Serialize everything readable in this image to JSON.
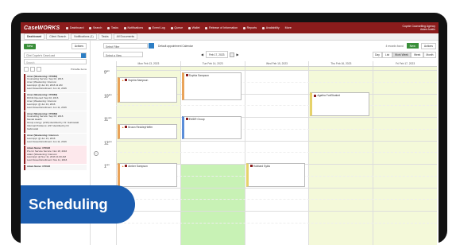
{
  "app": {
    "logo": "CaseWORKS"
  },
  "nav": [
    {
      "label": "Dashboard"
    },
    {
      "label": "Search"
    },
    {
      "label": "Tasks"
    },
    {
      "label": "Notifications"
    },
    {
      "label": "Event Log"
    },
    {
      "label": "Queue"
    },
    {
      "label": "Wallet"
    },
    {
      "label": "Release of Information"
    },
    {
      "label": "Reports"
    },
    {
      "label": "Availability"
    },
    {
      "label": "More"
    }
  ],
  "account": {
    "org": "Coyote Counselling Agency",
    "user": "Adam Austin"
  },
  "tabs": [
    {
      "label": "Dashboard",
      "active": true
    },
    {
      "label": "Client Search",
      "active": false
    },
    {
      "label": "Notifications (1)",
      "active": false
    },
    {
      "label": "Tasks",
      "active": false
    },
    {
      "label": "All Documents",
      "active": false
    }
  ],
  "sidebar": {
    "new_label": "New",
    "actions_label": "Actions",
    "caseload_select": "Clint Coyote's CaseLoad",
    "search_placeholder": "Search",
    "select_label": "Printable Items",
    "cards": [
      {
        "lines": [
          "Amer (Weekening: #70083)",
          "Counseling    Service: Sep 02, 2016",
          "Amer (Weekening: Intenvon",
          "Last Appt: @ Jun 13, 2016 11 AM",
          "Last Closed Enrollment: Jun 11, 2016"
        ],
        "pink": false
      },
      {
        "lines": [
          "Amer (Weekening: #70083)",
          "DCNA    Opened: Sep 02, 2016",
          "Amer (Weekening: Intenvon",
          "Last Appt: @ Jun 13, 2016",
          "Last Closed Enrollment: Jun 11, 2016"
        ],
        "pink": false
      },
      {
        "lines": [
          "Amer (Weekening: #70083)",
          "Counseling    Service: Sep 02, 2016",
          "Mental Health",
          "Group energy: (2/16) identified by: Dr. Gabrowski",
          "Informal Problems: 2/27 identified by Dr.",
          "Gabrowski"
        ],
        "pink": false
      },
      {
        "lines": [
          "Amer (Weekening: Intenvon",
          "Last Appt: @ Jun 13, 2016",
          "Last Closed Enrollment: Jun 11, 2016"
        ],
        "pink": false
      },
      {
        "lines": [
          "Adam Name: #70022",
          "Pre for Service    Service: Nov 18, 2016",
          "Adam (Weekening: Intenvon",
          "Last Appt: @ Nov 11, 2016 11:00 AM",
          "Last Closed Enrollment: Nov 11, 2016"
        ],
        "pink": true
      },
      {
        "lines": [
          "Adam Name: #70022"
        ],
        "pink": false
      }
    ]
  },
  "toolbar": {
    "filter_select": "Select Filter",
    "default_calendar": "Default appointment Calendar",
    "found_text": "4 records found",
    "new_label": "New",
    "actions_label": "Actions",
    "view_select": "Select a View",
    "date": "Feb 17, 2023",
    "views": [
      {
        "label": "Day",
        "active": false
      },
      {
        "label": "List",
        "active": false
      },
      {
        "label": "Work Week",
        "active": true
      },
      {
        "label": "Week",
        "active": false
      },
      {
        "label": "Month",
        "active": false
      }
    ]
  },
  "badge": {
    "label": "Scheduling"
  },
  "calendar": {
    "days": [
      "Mon Feb 13, 2023",
      "Tue Feb 14, 2023",
      "Wed Feb 15, 2023",
      "Thu Feb 16, 2023",
      "Fri Feb 17, 2023"
    ],
    "hours": [
      {
        "h": "9",
        "m": "am"
      },
      {
        "h": "10",
        "m": "am"
      },
      {
        "h": "11",
        "m": "am"
      },
      {
        "h": "12",
        "m": "pm"
      },
      {
        "h": "1",
        "m": "pm"
      },
      {
        "h": "2",
        "m": "pm"
      },
      {
        "h": "3",
        "m": "pm"
      }
    ],
    "events": [
      {
        "title": "Sophia Sampson"
      },
      {
        "title": "Sophia Sampson"
      },
      {
        "title": "Agatha FoxElizabet"
      },
      {
        "title": "EMDR Group"
      },
      {
        "title": "Brown ReckleyHeffer"
      },
      {
        "title": "Amber Sampson"
      },
      {
        "title": "Hubbard Sykis"
      }
    ],
    "colors": {
      "available": "#f4f9d9",
      "green": "#c8f2b5",
      "orange": "#e9a35a",
      "blue": "#5b8dd9",
      "yellow": "#e6d26a"
    }
  }
}
